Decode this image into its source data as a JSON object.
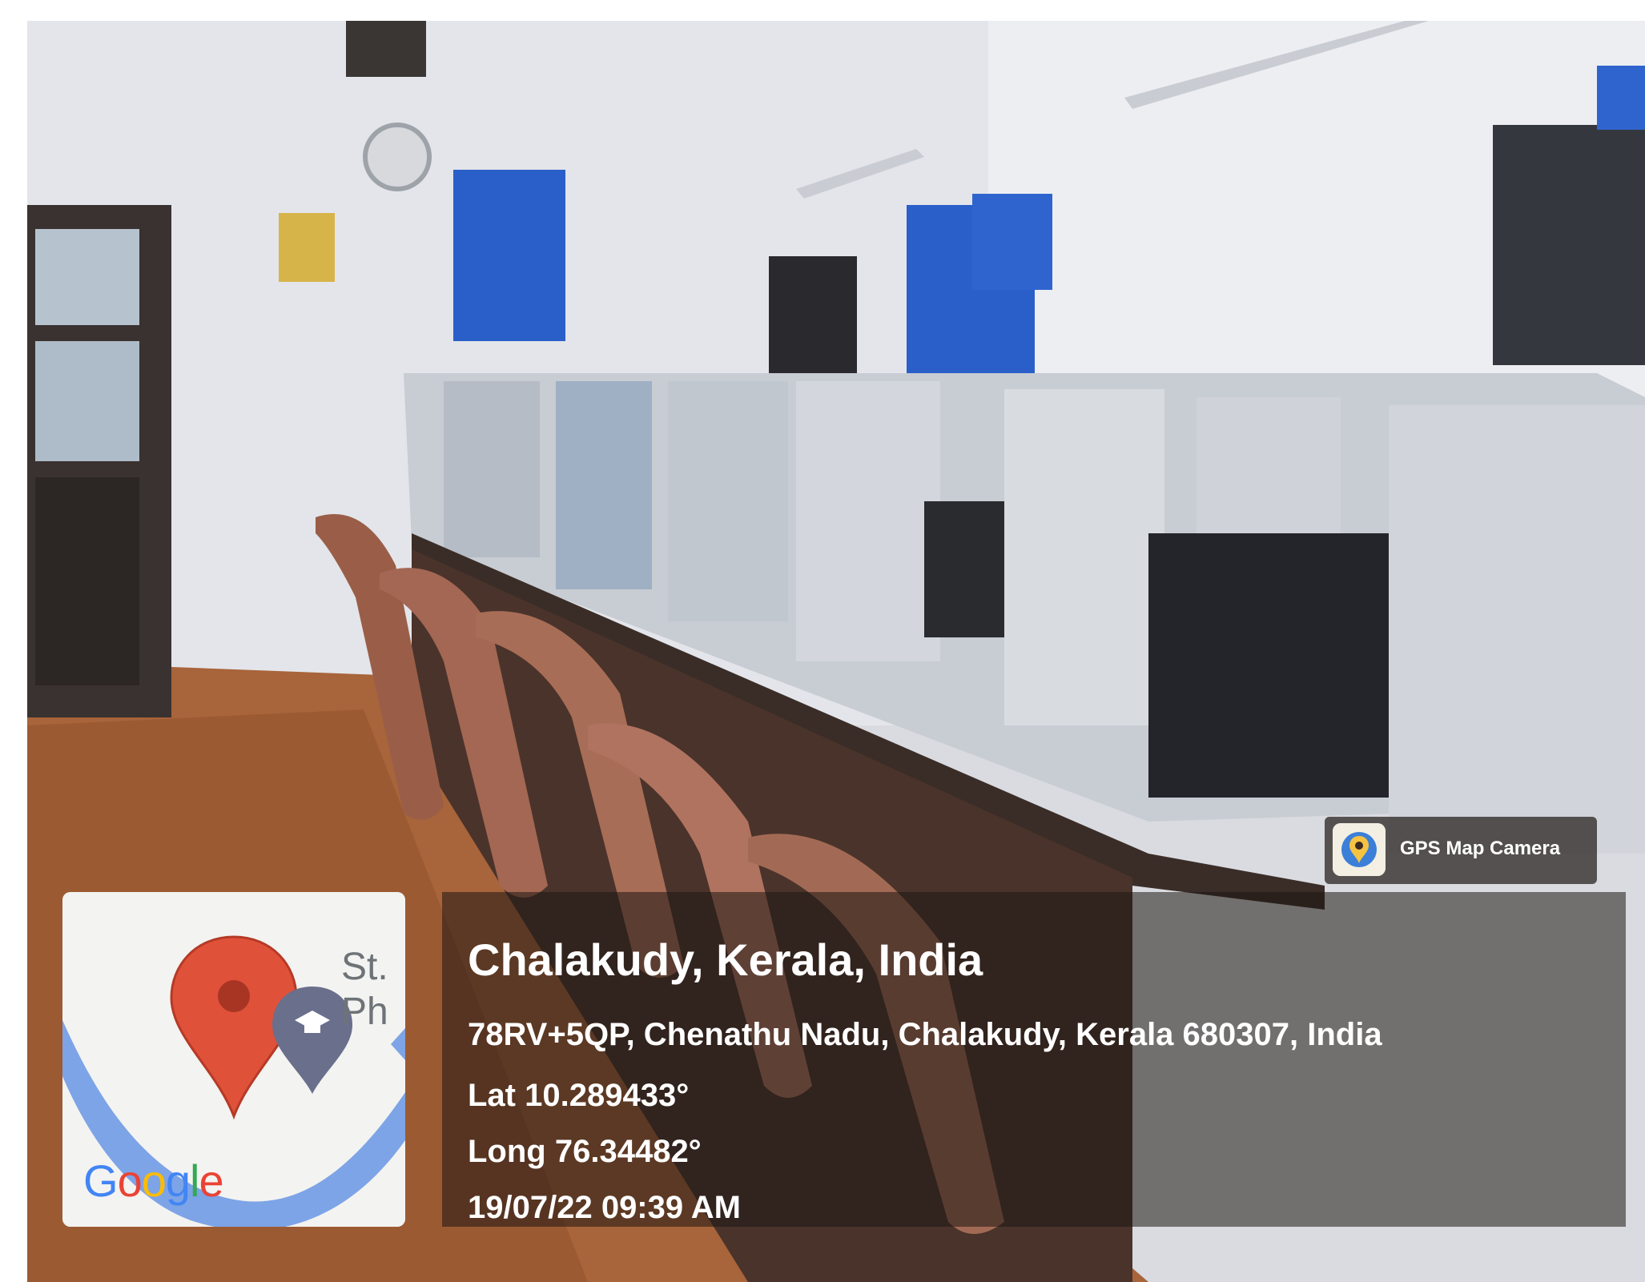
{
  "photo": {
    "subject": "computer-lab-interior"
  },
  "map": {
    "place_label_line1": "St.",
    "place_label_line2": "Ph",
    "logo_text": "Google",
    "pin_color": "#e0513a",
    "school_pin_color": "#6a6f8c",
    "river_color": "#7da4e6"
  },
  "overlay": {
    "title": "Chalakudy, Kerala, India",
    "address": "78RV+5QP, Chenathu Nadu, Chalakudy, Kerala 680307, India",
    "latitude": "Lat 10.289433°",
    "longitude": "Long 76.34482°",
    "timestamp": "19/07/22 09:39 AM"
  },
  "badge": {
    "app_name": "GPS Map Camera"
  }
}
